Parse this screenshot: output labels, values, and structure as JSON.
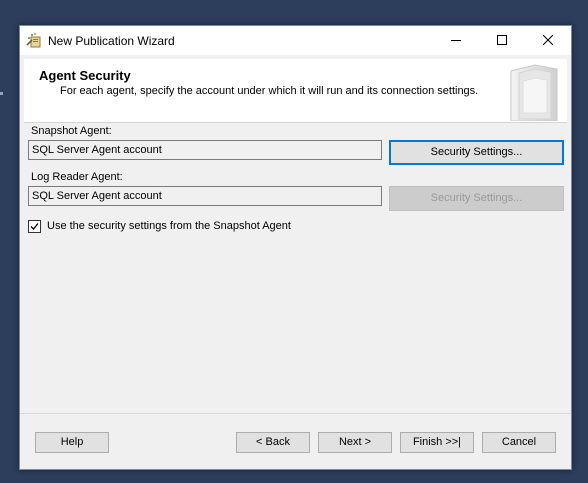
{
  "window": {
    "title": "New Publication Wizard",
    "icon": "wizard-app-icon",
    "controls": [
      "minimize-icon",
      "maximize-icon",
      "close-icon"
    ]
  },
  "header": {
    "title": "Agent Security",
    "description": "For each agent, specify the account under which it will run and its connection settings.",
    "graphic": "wizard-header-graphic"
  },
  "snapshot_agent": {
    "label": "Snapshot Agent:",
    "account": "SQL Server Agent account",
    "button_label": "Security Settings..."
  },
  "log_reader_agent": {
    "label": "Log Reader Agent:",
    "account": "SQL Server Agent account",
    "button_label": "Security Settings...",
    "button_enabled": false
  },
  "use_snapshot_settings": {
    "label": "Use the security settings from the Snapshot Agent",
    "checked": true
  },
  "footer": {
    "help": "Help",
    "back": "< Back",
    "next": "Next >",
    "finish": "Finish >>|",
    "cancel": "Cancel"
  },
  "colors": {
    "desktop": "#2c3e5c",
    "dialog": "#f0f0f0",
    "focus_border": "#0078d7",
    "disabled_text": "#9a9a9a"
  }
}
